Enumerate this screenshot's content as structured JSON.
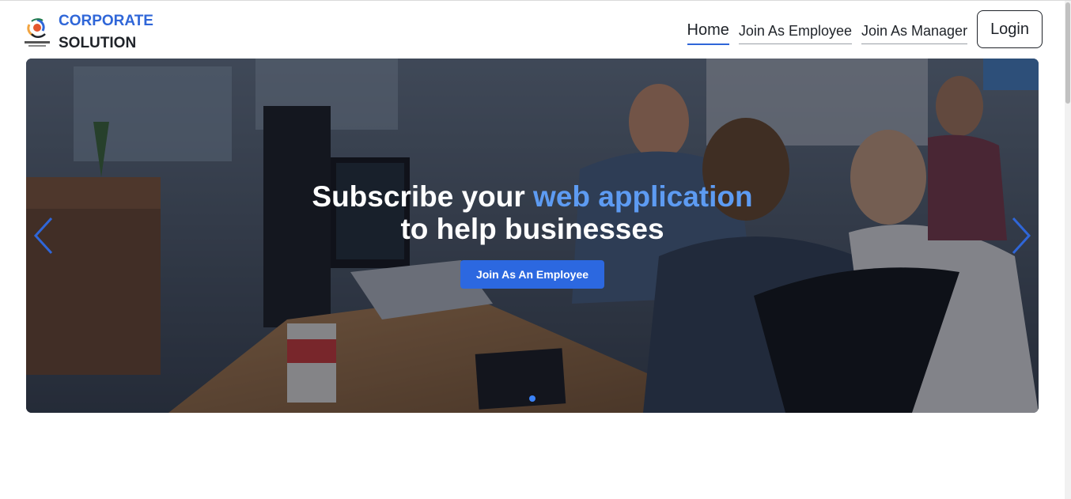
{
  "brand": {
    "line1": "CORPORATE",
    "line2": "SOLUTION",
    "logo_icon": "corporate-solution-logo",
    "logo_caption": "CORPORATE SOLUTION"
  },
  "nav": {
    "home": "Home",
    "join_employee": "Join As Employee",
    "join_manager": "Join As Manager",
    "login": "Login"
  },
  "hero": {
    "headline_part1": "Subscribe your ",
    "headline_accent": "web application",
    "headline_line2": "to help businesses",
    "cta_label": "Join As An Employee",
    "prev_icon": "chevron-left-icon",
    "next_icon": "chevron-right-icon",
    "active_slide": 1,
    "slide_count": 1
  },
  "colors": {
    "brand_blue": "#2f66d8",
    "accent_text": "#5d9bf2",
    "cta_bg": "#2c68e0",
    "arrow": "#2f66d8"
  }
}
